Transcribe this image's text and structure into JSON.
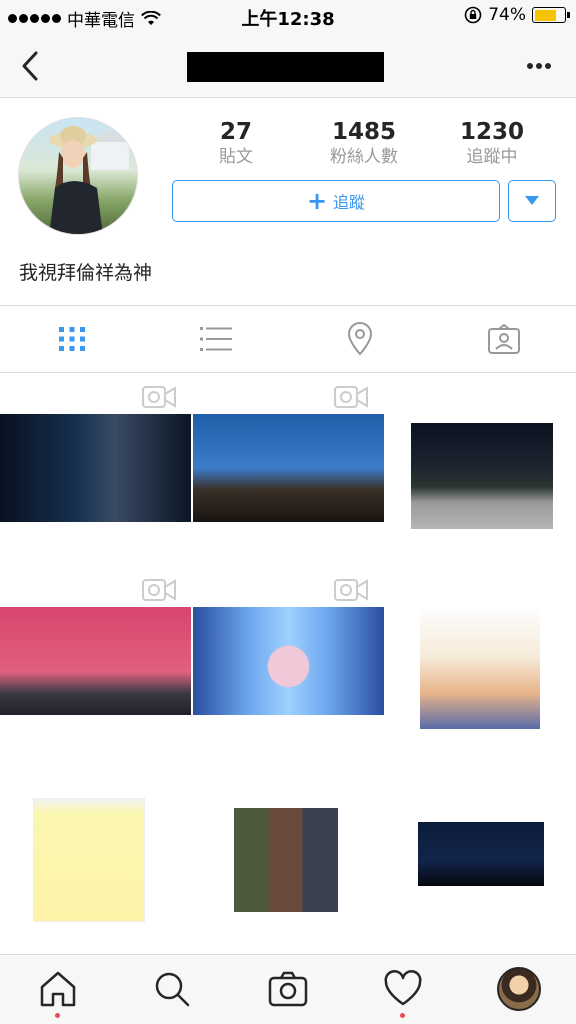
{
  "status_bar": {
    "carrier": "中華電信",
    "time": "上午12:38",
    "battery_percent": "74%"
  },
  "nav": {
    "back_icon": "chevron-left-icon",
    "more_icon": "ellipsis-icon"
  },
  "profile": {
    "stats": [
      {
        "value": "27",
        "label": "貼文"
      },
      {
        "value": "1485",
        "label": "粉絲人數"
      },
      {
        "value": "1230",
        "label": "追蹤中"
      }
    ],
    "follow_label": "追蹤",
    "bio": "我視拜倫祥為神"
  },
  "tabs": [
    {
      "name": "grid-view",
      "icon": "grid-icon",
      "active": true
    },
    {
      "name": "list-view",
      "icon": "list-icon",
      "active": false
    },
    {
      "name": "places",
      "icon": "location-pin-icon",
      "active": false
    },
    {
      "name": "tagged",
      "icon": "tagged-person-icon",
      "active": false
    }
  ],
  "posts": [
    {
      "type": "video",
      "desc": "dark blue music video still"
    },
    {
      "type": "video",
      "desc": "stage dance performance"
    },
    {
      "type": "photo",
      "desc": "night outdoor crowd"
    },
    {
      "type": "video",
      "desc": "group on red car"
    },
    {
      "type": "video",
      "desc": "dancer blue hexagon wall"
    },
    {
      "type": "photo",
      "desc": "webtoon cover"
    },
    {
      "type": "photo",
      "desc": "hand drawn note"
    },
    {
      "type": "photo",
      "desc": "face collage"
    },
    {
      "type": "photo",
      "desc": "stage bowing performers"
    }
  ],
  "colors": {
    "accent": "#3897f0",
    "notification": "#ed4956",
    "battery": "#f5c300"
  }
}
